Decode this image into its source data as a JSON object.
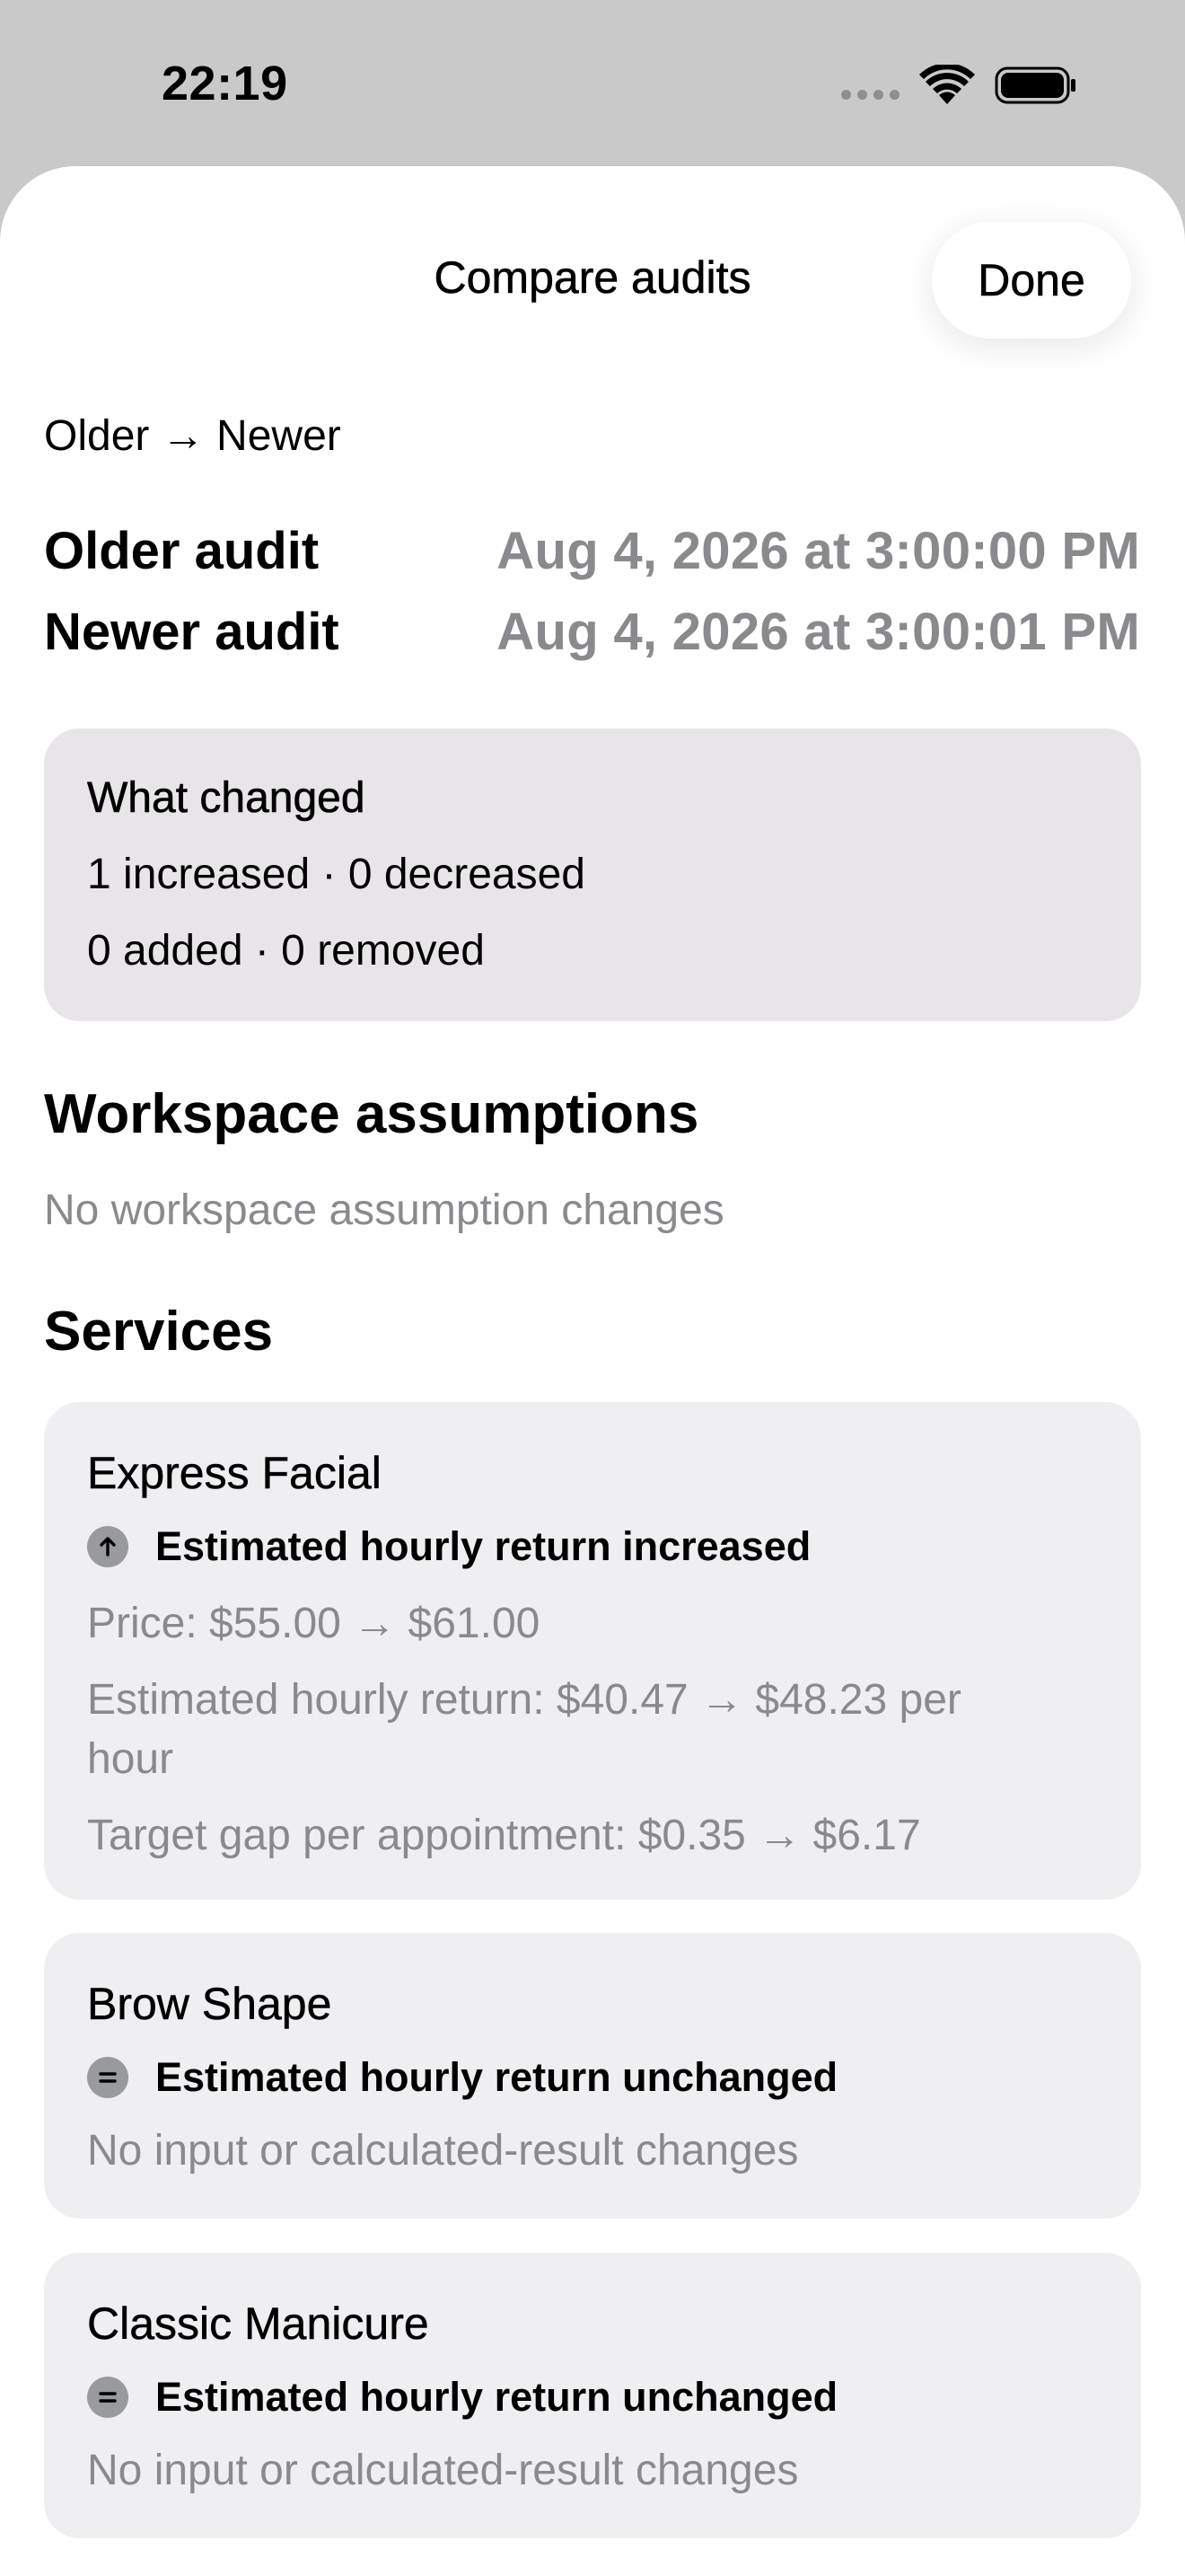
{
  "status_bar": {
    "time": "22:19"
  },
  "nav": {
    "title": "Compare audits",
    "done_label": "Done"
  },
  "direction_label": "Older → Newer",
  "audits": {
    "older_label": "Older audit",
    "older_value": "Aug 4, 2026 at 3:00:00 PM",
    "newer_label": "Newer audit",
    "newer_value": "Aug 4, 2026 at 3:00:01 PM"
  },
  "what_changed": {
    "title": "What changed",
    "line1": "1 increased · 0 decreased",
    "line2": "0 added · 0 removed"
  },
  "workspace": {
    "title": "Workspace assumptions",
    "empty_text": "No workspace assumption changes"
  },
  "services": {
    "title": "Services",
    "items": [
      {
        "name": "Express Facial",
        "status_icon": "arrow-up-circle-icon",
        "status": "Estimated hourly return increased",
        "details": [
          "Price: $55.00 → $61.00",
          "Estimated hourly return: $40.47 → $48.23 per hour",
          "Target gap per appointment: $0.35 → $6.17"
        ]
      },
      {
        "name": "Brow Shape",
        "status_icon": "equal-circle-icon",
        "status": "Estimated hourly return unchanged",
        "details": [
          "No input or calculated-result changes"
        ]
      },
      {
        "name": "Classic Manicure",
        "status_icon": "equal-circle-icon",
        "status": "Estimated hourly return unchanged",
        "details": [
          "No input or calculated-result changes"
        ]
      }
    ]
  }
}
